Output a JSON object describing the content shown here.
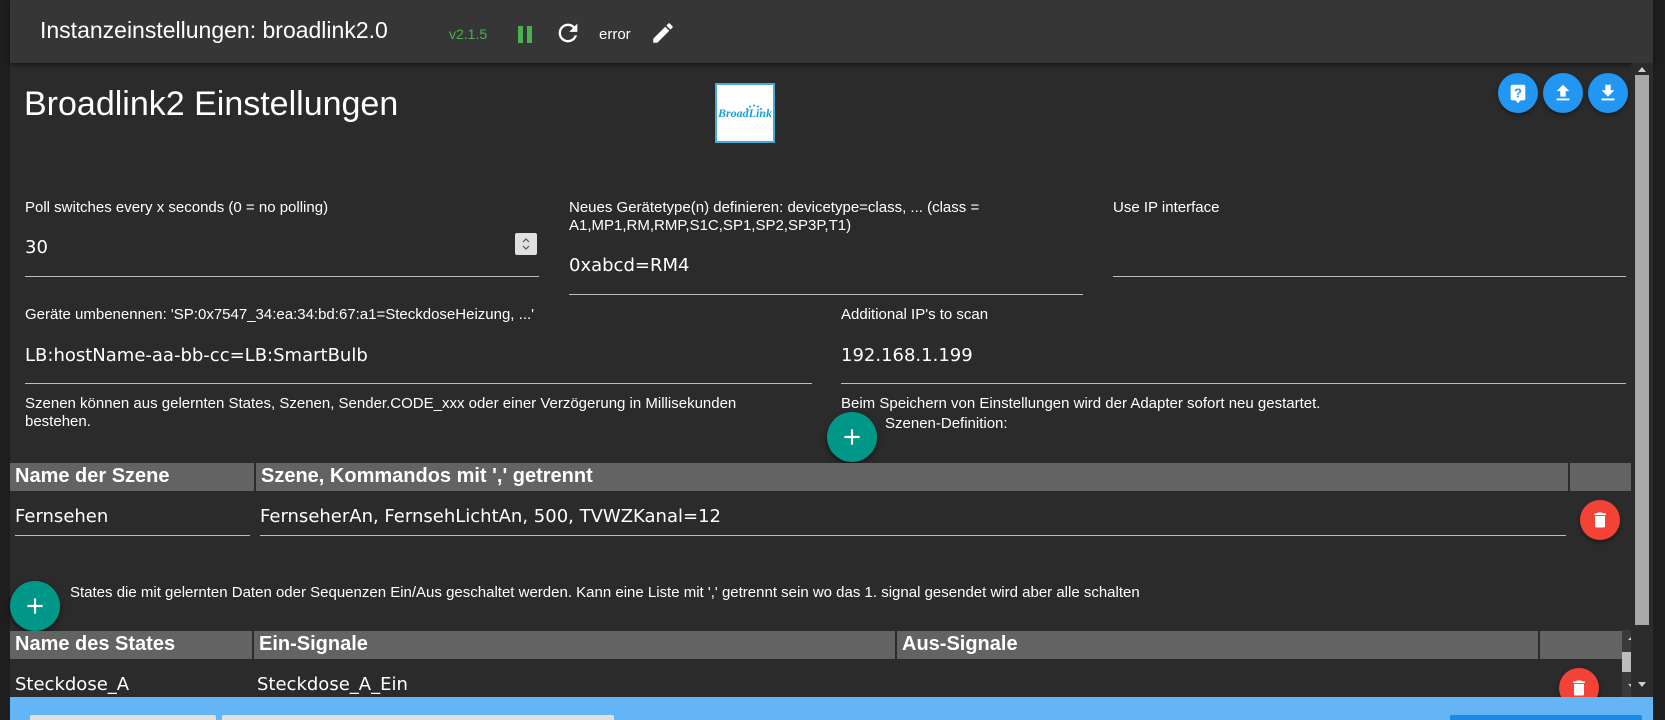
{
  "header": {
    "title": "Instanzeinstellungen: broadlink2.0",
    "version": "v2.1.5",
    "status": "error"
  },
  "main": {
    "heading": "Broadlink2 Einstellungen",
    "logo_text": "BroadLink"
  },
  "fields": {
    "poll": {
      "label": "Poll switches every x seconds (0 = no polling)",
      "value": "30"
    },
    "devicetype": {
      "label": "Neues Gerätetype(n) definieren: devicetype=class, ... (class = A1,MP1,RM,RMP,S1C,SP1,SP2,SP3P,T1)",
      "value": "0xabcd=RM4"
    },
    "use_ip": {
      "label": "Use IP interface",
      "value": ""
    },
    "rename": {
      "label": "Geräte umbenennen: 'SP:0x7547_34:ea:34:bd:67:a1=SteckdoseHeizung, ...'",
      "value": "LB:hostName-aa-bb-cc=LB:SmartBulb"
    },
    "additional_ips": {
      "label": "Additional IP's to scan",
      "value": "192.168.1.199"
    }
  },
  "info": {
    "scenes_desc": "Szenen können aus gelernten States, Szenen, Sender.CODE_xxx oder einer Verzögerung in Millisekunden bestehen.",
    "restart_notice": "Beim Speichern von Einstellungen wird der Adapter sofort neu gestartet.",
    "scene_def_label": "Szenen-Definition:",
    "states_desc": "States die mit gelernten Daten oder Sequenzen Ein/Aus geschaltet werden. Kann eine Liste mit ',' getrennt sein wo das 1. signal gesendet wird aber alle schalten"
  },
  "scenes_table": {
    "headers": [
      "Name der Szene",
      "Szene, Kommandos mit ',' getrennt"
    ],
    "rows": [
      {
        "name": "Fernsehen",
        "commands": "FernseherAn, FernsehLichtAn, 500, TVWZKanal=12"
      }
    ]
  },
  "states_table": {
    "headers": [
      "Name des States",
      "Ein-Signale",
      "Aus-Signale"
    ],
    "rows": [
      {
        "name": "Steckdose_A",
        "on": "Steckdose_A_Ein",
        "off": ""
      }
    ]
  },
  "colors": {
    "accent_blue": "#2196f3",
    "add_green": "#009688",
    "delete_red": "#f44336",
    "version_green": "#4caf50",
    "footer_blue": "#64b5f6"
  },
  "icons": {
    "pause": "pause-icon",
    "reload": "reload-icon",
    "edit": "pencil-icon",
    "help": "help-icon",
    "upload": "upload-icon",
    "download": "download-icon",
    "add": "plus-icon",
    "delete": "trash-icon"
  }
}
